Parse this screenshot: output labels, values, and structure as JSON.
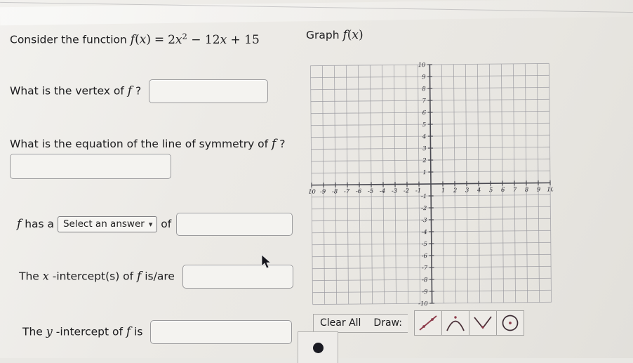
{
  "problem": {
    "prompt_prefix": "Consider the function ",
    "function_lhs": "f(x)",
    "function_eq": "=",
    "function_rhs_a": "2x",
    "function_rhs_exp": "2",
    "function_rhs_b": "− 12x + 15",
    "function_full": "f(x) = 2x² − 12x + 15"
  },
  "questions": {
    "vertex": {
      "text_a": "What is the vertex of ",
      "fvar": "f",
      "text_b": " ?",
      "value": "",
      "placeholder": ""
    },
    "symmetry": {
      "text_a": "What is the equation of the line of symmetry of ",
      "fvar": "f",
      "text_b": " ?",
      "value": "",
      "placeholder": ""
    },
    "extremum": {
      "text_a": "f",
      "text_b": " has a ",
      "select_label": "Select an answer",
      "select_options": [
        "Select an answer"
      ],
      "chevron": "∨",
      "text_c": " of ",
      "value": "",
      "placeholder": ""
    },
    "x_intercepts": {
      "text_a": "The ",
      "var": "x",
      "text_b": " -intercept(s) of ",
      "fvar": "f",
      "text_c": " is/are",
      "value": "",
      "placeholder": ""
    },
    "y_intercept": {
      "text_a": "The ",
      "var": "y",
      "text_b": " -intercept of ",
      "fvar": "f",
      "text_c": " is",
      "value": "",
      "placeholder": ""
    }
  },
  "graph_panel": {
    "title_prefix": "Graph ",
    "title_func": "f(x)",
    "clear_all_label": "Clear All",
    "draw_label": "Draw:",
    "tools": [
      {
        "name": "line-tool",
        "label": "Line"
      },
      {
        "name": "parabola-tool",
        "label": "Parabola"
      },
      {
        "name": "absolute-value-tool",
        "label": "Absolute Value"
      },
      {
        "name": "circle-tool",
        "label": "Circle"
      }
    ],
    "point_tool": {
      "name": "point-tool",
      "label": "Point"
    }
  },
  "chart_data": {
    "type": "scatter",
    "title": "Graph f(x)",
    "xlabel": "",
    "ylabel": "",
    "xlim": [
      -10,
      10
    ],
    "ylim": [
      -10,
      10
    ],
    "grid": true,
    "x_ticks": [
      -10,
      -9,
      -8,
      -7,
      -6,
      -5,
      -4,
      -3,
      -2,
      -1,
      1,
      2,
      3,
      4,
      5,
      6,
      7,
      8,
      9,
      10
    ],
    "y_ticks": [
      -10,
      -9,
      -8,
      -7,
      -6,
      -5,
      -4,
      -3,
      -2,
      -1,
      1,
      2,
      3,
      4,
      5,
      6,
      7,
      8,
      9,
      10
    ],
    "x_tick_labels": [
      "-10",
      "-9",
      "-8",
      "-7",
      "-6",
      "-5",
      "-4",
      "-3",
      "-2",
      "-1",
      "1",
      "2",
      "3",
      "4",
      "5",
      "6",
      "7",
      "8",
      "9",
      "10"
    ],
    "y_tick_labels": [
      "-10",
      "-9",
      "-8",
      "-7",
      "-6",
      "-5",
      "-4",
      "-3",
      "-2",
      "-1",
      "1",
      "2",
      "3",
      "4",
      "5",
      "6",
      "7",
      "8",
      "9",
      "10"
    ],
    "series": [],
    "legend": "none",
    "note": "Empty coordinate grid; no curve plotted yet"
  },
  "colors": {
    "page_background": "#eceae6",
    "grid_line": "#9a9aa0",
    "axis_line": "#4a4a52",
    "tick_label": "#2b2b33",
    "input_border": "#9a9a9c",
    "tool_accent": "#8d3b4a"
  }
}
